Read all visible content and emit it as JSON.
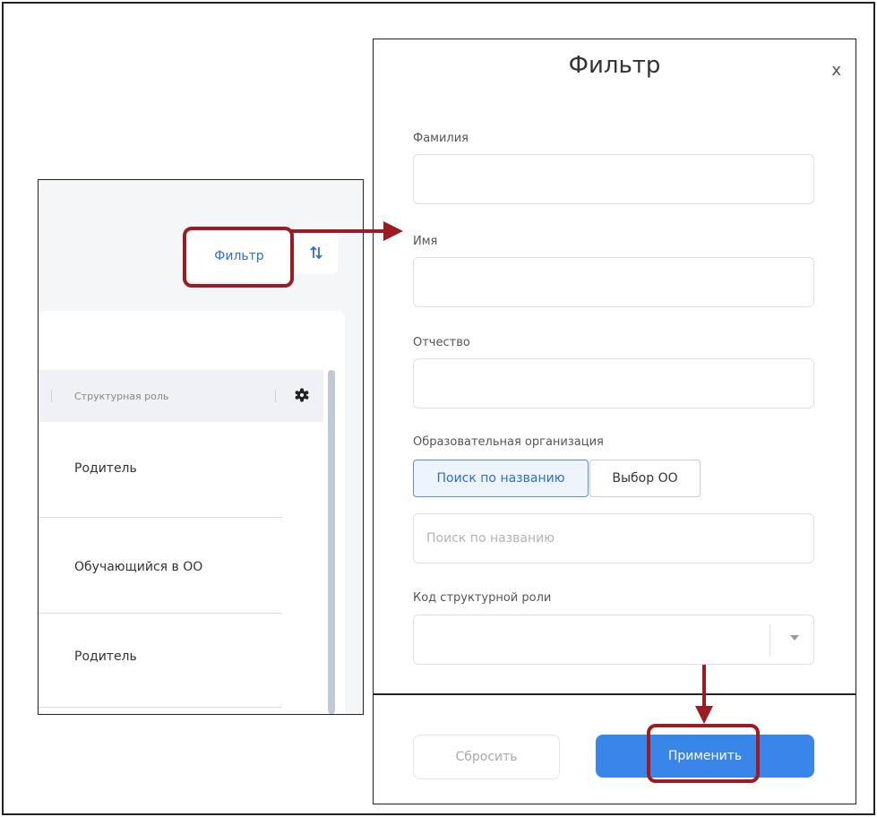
{
  "left_panel": {
    "filter_button": "Фильтр",
    "column_header": "Структурная роль",
    "rows": [
      "Родитель",
      "Обучающийся в ОО",
      "Родитель"
    ]
  },
  "modal": {
    "title": "Фильтр",
    "close": "x",
    "last_name_label": "Фамилия",
    "first_name_label": "Имя",
    "patronymic_label": "Отчество",
    "org_label": "Образовательная организация",
    "org_tabs": [
      "Поиск по названию",
      "Выбор ОО"
    ],
    "org_search_placeholder": "Поиск по названию",
    "role_code_label": "Код структурной роли",
    "reset_button": "Сбросить",
    "apply_button": "Применить"
  },
  "colors": {
    "accent": "#2f6fcb",
    "apply": "#3a86e8",
    "annotation": "#9b1c22"
  },
  "icons": [
    "sort-icon",
    "settings-gear-icon",
    "close-icon",
    "chevron-down-icon",
    "arrow-right-icon",
    "arrow-down-icon"
  ]
}
